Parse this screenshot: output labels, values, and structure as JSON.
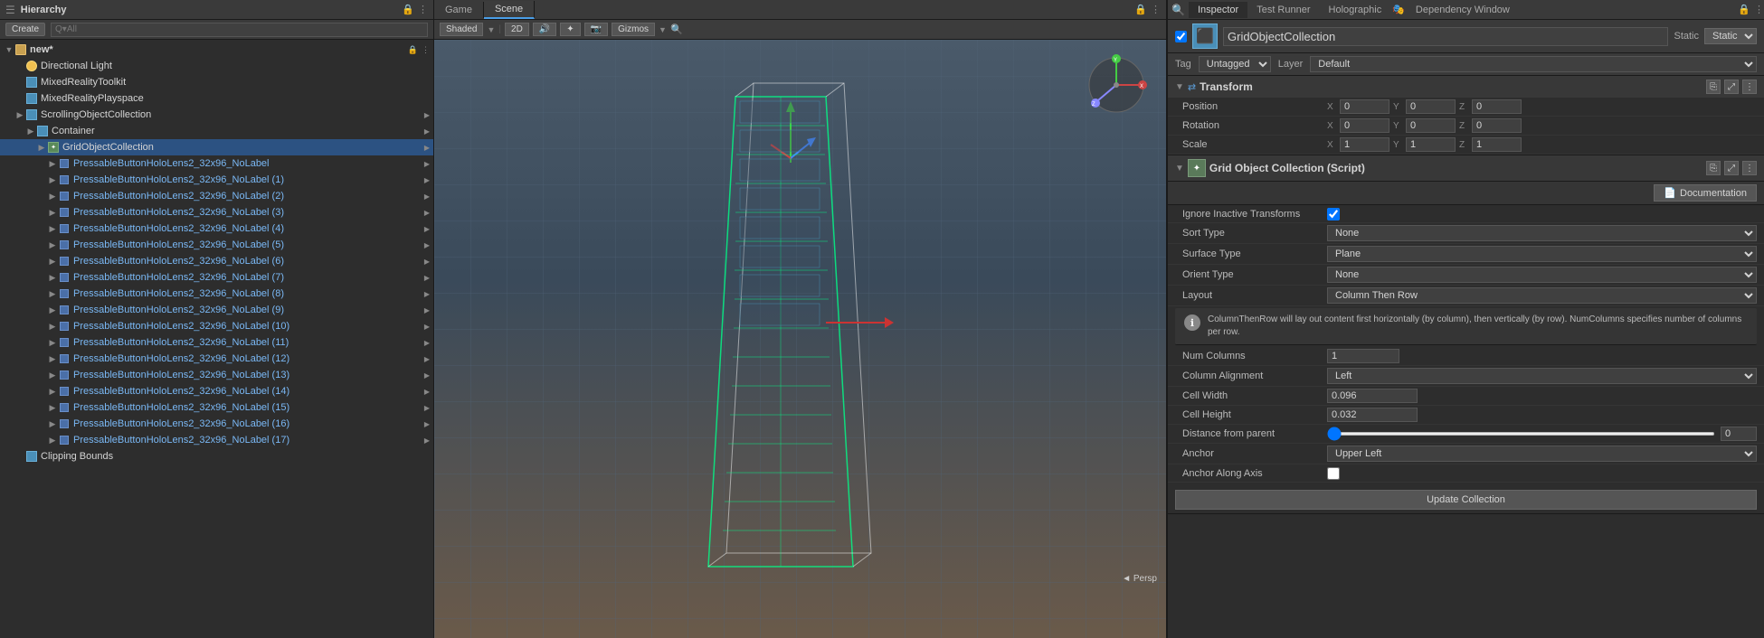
{
  "hierarchy": {
    "title": "Hierarchy",
    "create_label": "Create",
    "search_placeholder": "Q▾All",
    "scene_name": "new*",
    "items": [
      {
        "id": "directional-light",
        "label": "Directional Light",
        "indent": 1,
        "icon": "light",
        "arrow": false
      },
      {
        "id": "mixed-reality-toolkit",
        "label": "MixedRealityToolkit",
        "indent": 1,
        "icon": "cube",
        "arrow": false
      },
      {
        "id": "mixed-reality-playspace",
        "label": "MixedRealityPlayspace",
        "indent": 1,
        "icon": "cube",
        "arrow": false
      },
      {
        "id": "scrolling-object-collection",
        "label": "ScrollingObjectCollection",
        "indent": 1,
        "icon": "cube",
        "arrow": true
      },
      {
        "id": "container",
        "label": "Container",
        "indent": 2,
        "icon": "cube",
        "arrow": true
      },
      {
        "id": "grid-object-collection",
        "label": "GridObjectCollection",
        "indent": 3,
        "icon": "script",
        "arrow": true,
        "selected": true
      },
      {
        "id": "btn0",
        "label": "PressableButtonHoloLens2_32x96_NoLabel",
        "indent": 4,
        "icon": "small-cube",
        "arrow": true,
        "highlighted": true
      },
      {
        "id": "btn1",
        "label": "PressableButtonHoloLens2_32x96_NoLabel (1)",
        "indent": 4,
        "icon": "small-cube",
        "arrow": true,
        "highlighted": true
      },
      {
        "id": "btn2",
        "label": "PressableButtonHoloLens2_32x96_NoLabel (2)",
        "indent": 4,
        "icon": "small-cube",
        "arrow": true,
        "highlighted": true
      },
      {
        "id": "btn3",
        "label": "PressableButtonHoloLens2_32x96_NoLabel (3)",
        "indent": 4,
        "icon": "small-cube",
        "arrow": true,
        "highlighted": true
      },
      {
        "id": "btn4",
        "label": "PressableButtonHoloLens2_32x96_NoLabel (4)",
        "indent": 4,
        "icon": "small-cube",
        "arrow": true,
        "highlighted": true
      },
      {
        "id": "btn5",
        "label": "PressableButtonHoloLens2_32x96_NoLabel (5)",
        "indent": 4,
        "icon": "small-cube",
        "arrow": true,
        "highlighted": true
      },
      {
        "id": "btn6",
        "label": "PressableButtonHoloLens2_32x96_NoLabel (6)",
        "indent": 4,
        "icon": "small-cube",
        "arrow": true,
        "highlighted": true
      },
      {
        "id": "btn7",
        "label": "PressableButtonHoloLens2_32x96_NoLabel (7)",
        "indent": 4,
        "icon": "small-cube",
        "arrow": true,
        "highlighted": true
      },
      {
        "id": "btn8",
        "label": "PressableButtonHoloLens2_32x96_NoLabel (8)",
        "indent": 4,
        "icon": "small-cube",
        "arrow": true,
        "highlighted": true
      },
      {
        "id": "btn9",
        "label": "PressableButtonHoloLens2_32x96_NoLabel (9)",
        "indent": 4,
        "icon": "small-cube",
        "arrow": true,
        "highlighted": true
      },
      {
        "id": "btn10",
        "label": "PressableButtonHoloLens2_32x96_NoLabel (10)",
        "indent": 4,
        "icon": "small-cube",
        "arrow": true,
        "highlighted": true
      },
      {
        "id": "btn11",
        "label": "PressableButtonHoloLens2_32x96_NoLabel (11)",
        "indent": 4,
        "icon": "small-cube",
        "arrow": true,
        "highlighted": true
      },
      {
        "id": "btn12",
        "label": "PressableButtonHoloLens2_32x96_NoLabel (12)",
        "indent": 4,
        "icon": "small-cube",
        "arrow": true,
        "highlighted": true
      },
      {
        "id": "btn13",
        "label": "PressableButtonHoloLens2_32x96_NoLabel (13)",
        "indent": 4,
        "icon": "small-cube",
        "arrow": true,
        "highlighted": true
      },
      {
        "id": "btn14",
        "label": "PressableButtonHoloLens2_32x96_NoLabel (14)",
        "indent": 4,
        "icon": "small-cube",
        "arrow": true,
        "highlighted": true
      },
      {
        "id": "btn15",
        "label": "PressableButtonHoloLens2_32x96_NoLabel (15)",
        "indent": 4,
        "icon": "small-cube",
        "arrow": true,
        "highlighted": true
      },
      {
        "id": "btn16",
        "label": "PressableButtonHoloLens2_32x96_NoLabel (16)",
        "indent": 4,
        "icon": "small-cube",
        "arrow": true,
        "highlighted": true
      },
      {
        "id": "btn17",
        "label": "PressableButtonHoloLens2_32x96_NoLabel (17)",
        "indent": 4,
        "icon": "small-cube",
        "arrow": true,
        "highlighted": true
      },
      {
        "id": "clipping-bounds",
        "label": "Clipping Bounds",
        "indent": 1,
        "icon": "cube",
        "arrow": false
      }
    ]
  },
  "scene": {
    "game_tab": "Game",
    "scene_tab": "Scene",
    "shaded_label": "Shaded",
    "2d_label": "2D",
    "gizmos_label": "Gizmos",
    "persp_label": "◄ Persp"
  },
  "inspector": {
    "title": "Inspector",
    "test_runner_tab": "Test Runner",
    "holographic_tab": "Holographic",
    "dependency_window_tab": "Dependency Window",
    "object_name": "GridObjectCollection",
    "static_label": "Static",
    "tag_label": "Tag",
    "tag_value": "Untagged",
    "layer_label": "Layer",
    "layer_value": "Default",
    "transform": {
      "title": "Transform",
      "position_label": "Position",
      "pos_x": "0",
      "pos_y": "0",
      "pos_z": "0",
      "rotation_label": "Rotation",
      "rot_x": "0",
      "rot_y": "0",
      "rot_z": "0",
      "scale_label": "Scale",
      "scale_x": "1",
      "scale_y": "1",
      "scale_z": "1"
    },
    "script": {
      "title": "Grid Object Collection (Script)",
      "documentation_label": "Documentation",
      "ignore_inactive_label": "Ignore Inactive Transforms",
      "ignore_inactive_checked": true,
      "sort_type_label": "Sort Type",
      "sort_type_value": "None",
      "surface_type_label": "Surface Type",
      "surface_type_value": "Plane",
      "orient_type_label": "Orient Type",
      "orient_type_value": "None",
      "layout_label": "Layout",
      "layout_value": "Column Then Row",
      "info_text": "ColumnThenRow will lay out content first horizontally (by column), then vertically (by row). NumColumns specifies number of columns per row.",
      "num_columns_label": "Num Columns",
      "num_columns_value": "1",
      "column_alignment_label": "Column Alignment",
      "column_alignment_value": "Left",
      "cell_width_label": "Cell Width",
      "cell_width_value": "0.096",
      "cell_height_label": "Cell Height",
      "cell_height_value": "0.032",
      "distance_from_parent_label": "Distance from parent",
      "distance_from_parent_value": "0",
      "anchor_label": "Anchor",
      "anchor_value": "Upper Left",
      "anchor_along_axis_label": "Anchor Along Axis",
      "anchor_along_axis_checked": false,
      "update_btn_label": "Update Collection"
    }
  }
}
